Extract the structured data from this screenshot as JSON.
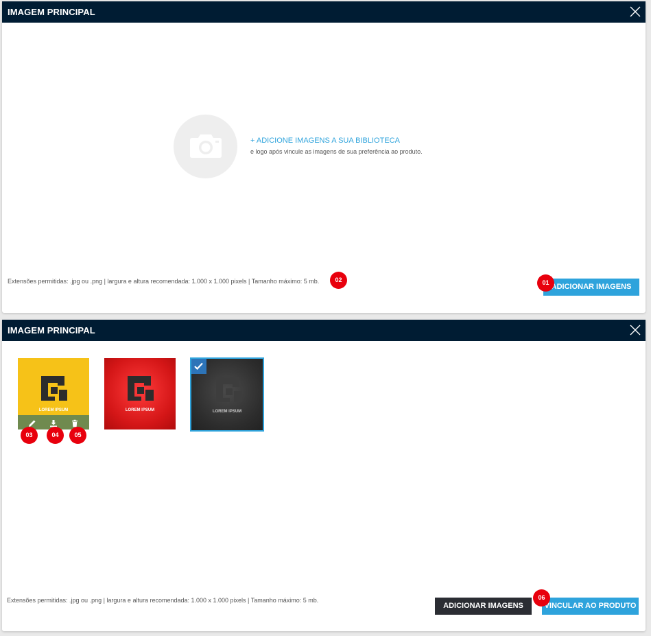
{
  "panel1": {
    "title": "IMAGEM PRINCIPAL",
    "close_icon": "close-icon",
    "empty_state": {
      "icon": "camera-icon",
      "add_link": "+ ADICIONE IMAGENS A SUA BIBLIOTECA",
      "subtext": "e logo após vincule as imagens de sua preferência ao produto."
    },
    "footer_info": "Extensões permitidas: .jpg ou .png | largura e altura recomendada: 1.000 x 1.000 pixels | Tamanho máximo: 5 mb.",
    "add_button": "ADICIONAR IMAGENS",
    "badges": [
      "01",
      "02"
    ]
  },
  "panel2": {
    "title": "IMAGEM PRINCIPAL",
    "close_icon": "close-icon",
    "thumbnails": [
      {
        "color": "#f6c218",
        "text": "LOREM IPSUM",
        "selected": false
      },
      {
        "color": "#d41617",
        "text": "LOREM IPSUM",
        "selected": false
      },
      {
        "color": "#2c2c2c",
        "text": "LOREM IPSUM",
        "selected": true
      }
    ],
    "thumb_action_icons": [
      "edit-icon",
      "download-icon",
      "trash-icon"
    ],
    "badges": [
      "03",
      "04",
      "05",
      "06"
    ],
    "footer_info": "Extensões permitidas: .jpg ou .png | largura e altura recomendada: 1.000 x 1.000 pixels | Tamanho máximo: 5 mb.",
    "add_button": "ADICIONAR IMAGENS",
    "link_button": "VINCULAR AO PRODUTO"
  },
  "colors": {
    "header_bg": "#001c33",
    "accent_blue": "#2ea3dc",
    "dark_button": "#2b2d33",
    "badge_red": "#e8000d"
  }
}
